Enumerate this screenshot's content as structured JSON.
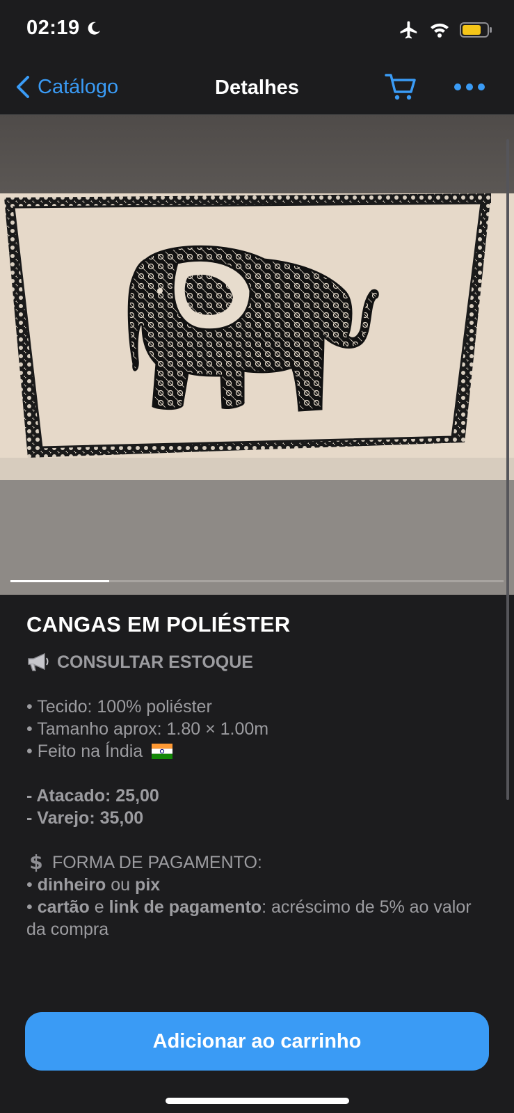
{
  "status": {
    "time": "02:19",
    "icons": [
      "moon-icon",
      "airplane-icon",
      "wifi-icon",
      "battery-icon"
    ],
    "battery_color": "#f5c518"
  },
  "nav": {
    "back_label": "Catálogo",
    "title": "Detalhes",
    "icons": [
      "chevron-left-icon",
      "cart-icon",
      "ellipsis-icon"
    ],
    "accent": "#3a9bf5"
  },
  "gallery": {
    "image_description": "Canga bege com estampa de elefante preto e moldura rendada",
    "current_page_fraction": 0.2
  },
  "product": {
    "title": "CANGAS EM POLIÉSTER",
    "stock_icon": "megaphone-icon",
    "stock_label": "CONSULTAR ESTOQUE",
    "specs": [
      "• Tecido: 100% poliéster",
      "• Tamanho aprox: 1.80 × 1.00m",
      "• Feito na Índia"
    ],
    "flag_icon": "india-flag-icon",
    "prices": {
      "wholesale_label": "- Atacado:",
      "wholesale_value": "25,00",
      "retail_label": "- Varejo:",
      "retail_value": "35,00"
    },
    "payment": {
      "icon": "dollar-sign-icon",
      "heading": "FORMA DE PAGAMENTO:",
      "line1_bullet": "•",
      "line1_a": "dinheiro",
      "line1_mid": "ou",
      "line1_b": "pix",
      "line2_bullet": "•",
      "line2_a": "cartão",
      "line2_mid": "e",
      "line2_b": "link de pagamento",
      "line2_rest": ": acréscimo de 5% ao valor da compra"
    }
  },
  "actions": {
    "add_to_cart_label": "Adicionar ao carrinho",
    "button_color": "#3a9bf5"
  }
}
